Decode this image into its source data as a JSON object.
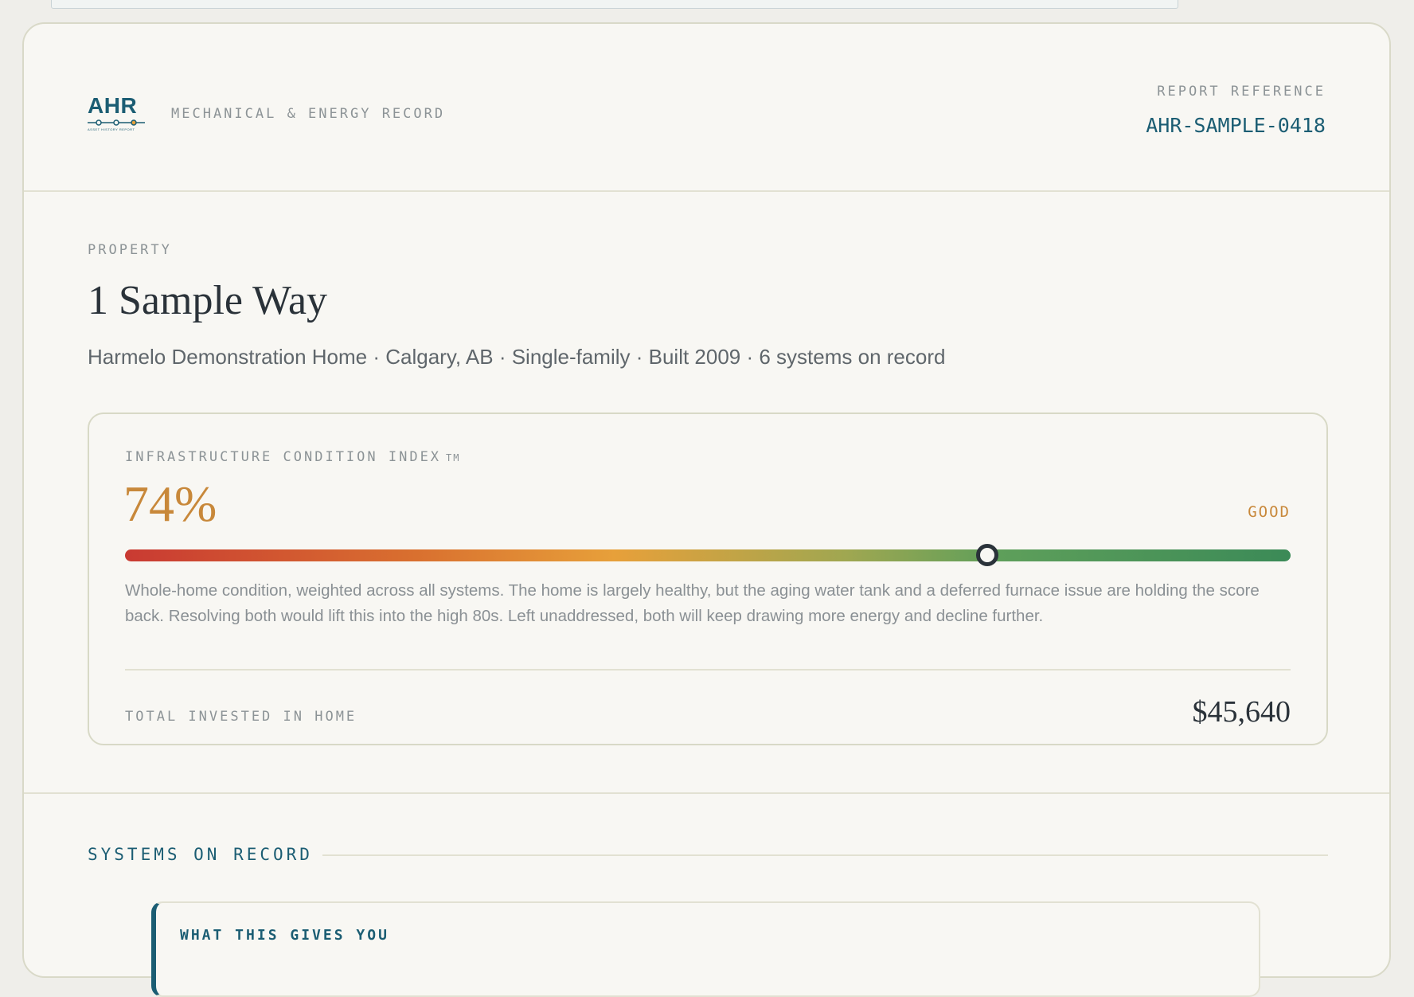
{
  "brand": {
    "logo_text": "AHR",
    "logo_tagline": "ASSET HISTORY REPORT",
    "subtitle": "MECHANICAL & ENERGY RECORD"
  },
  "report": {
    "ref_label": "REPORT REFERENCE",
    "ref_value": "AHR-SAMPLE-0418"
  },
  "property": {
    "label": "PROPERTY",
    "name": "1 Sample Way",
    "meta": "Harmelo Demonstration Home · Calgary, AB · Single-family · Built 2009 · 6 systems on record"
  },
  "condition_index": {
    "label": "INFRASTRUCTURE CONDITION INDEX",
    "trademark": "TM",
    "value_text": "74%",
    "value": 0.74,
    "status": "GOOD",
    "description": "Whole-home condition, weighted across all systems. The home is largely healthy, but the aging water tank and a deferred furnace issue are holding the score back. Resolving both would lift this into the high 80s. Left unaddressed, both will keep drawing more energy and decline further.",
    "gauge_colors": [
      "#c93a32",
      "#e7a03a",
      "#3b8a57"
    ]
  },
  "investment": {
    "label": "TOTAL INVESTED IN HOME",
    "value": "$45,640"
  },
  "systems": {
    "heading": "SYSTEMS ON RECORD",
    "callout_title": "WHAT THIS GIVES YOU"
  },
  "colors": {
    "accent": "#1b5d73",
    "score": "#c8883a",
    "text_dark": "#2a3239",
    "text_muted": "#8c9396"
  }
}
